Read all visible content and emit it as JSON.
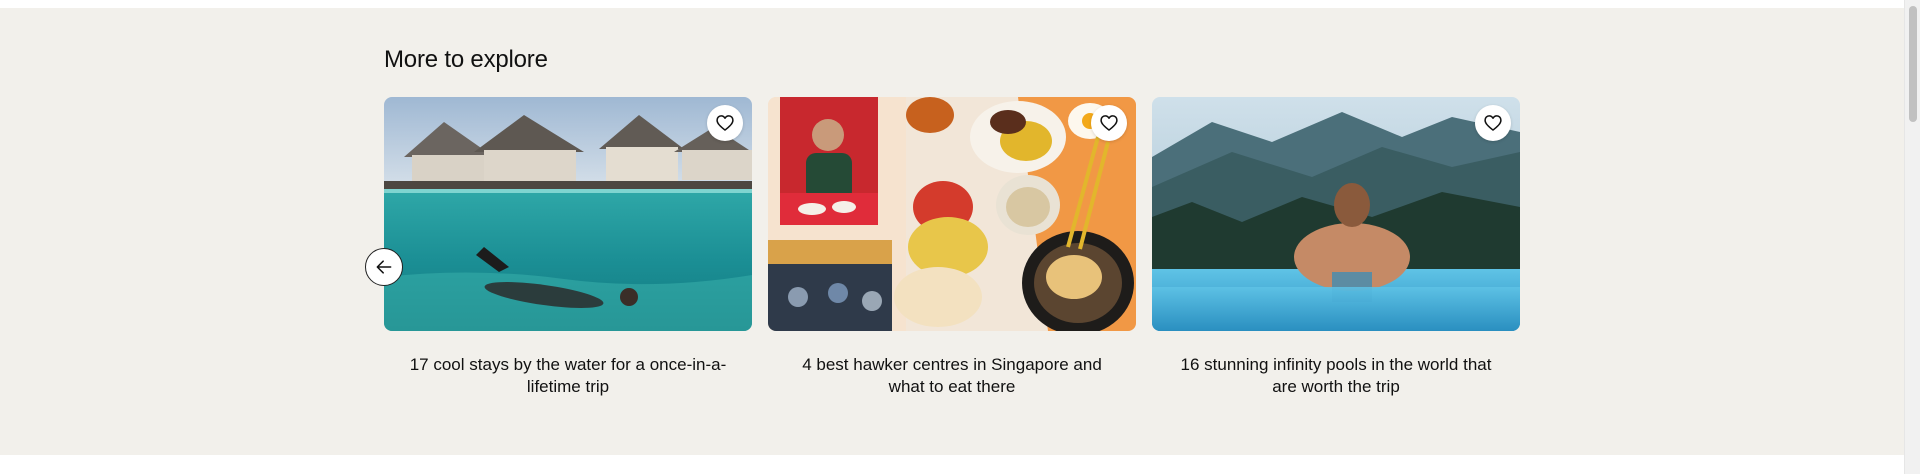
{
  "section": {
    "heading": "More to explore"
  },
  "carousel": {
    "prev_icon": "arrow-left-icon",
    "cards": [
      {
        "title": "17 cool stays by the water for a once-in-a-lifetime trip",
        "image": "overwater villas with swimmer underwater",
        "favorite_icon": "heart-icon"
      },
      {
        "title": "4 best hawker centres in Singapore and what to eat there",
        "image": "collage of hawker food and diners",
        "favorite_icon": "heart-icon"
      },
      {
        "title": "16 stunning infinity pools in the world that are worth the trip",
        "image": "woman in infinity pool facing mountains",
        "favorite_icon": "heart-icon"
      }
    ]
  },
  "colors": {
    "section_bg": "#f2f0eb",
    "text": "#111111"
  }
}
